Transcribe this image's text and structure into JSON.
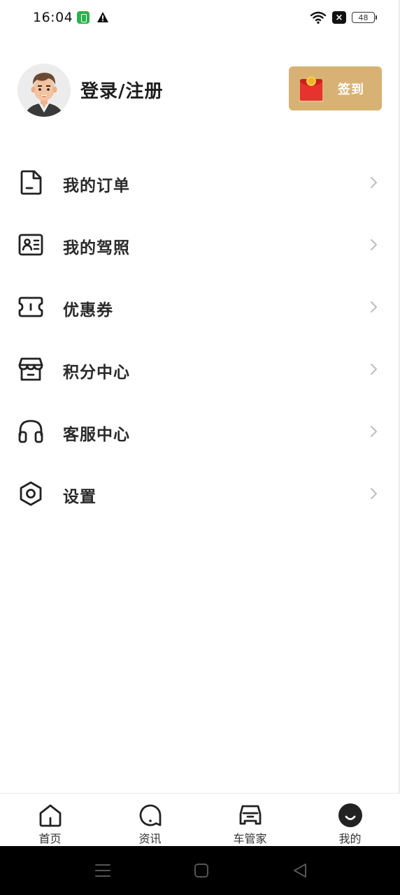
{
  "status_bar": {
    "time": "16:04",
    "app_icon": "app-notification-icon",
    "warning_icon": "warning-icon",
    "wifi_icon": "wifi-icon",
    "sim_icon": "x-sim-icon",
    "battery": "48"
  },
  "profile": {
    "login_label": "登录/注册",
    "checkin_label": "签到",
    "accent_color": "#d8b174"
  },
  "menu": {
    "items": [
      {
        "label": "我的订单",
        "icon": "document-icon"
      },
      {
        "label": "我的驾照",
        "icon": "license-card-icon"
      },
      {
        "label": "优惠券",
        "icon": "coupon-ticket-icon"
      },
      {
        "label": "积分中心",
        "icon": "store-icon"
      },
      {
        "label": "客服中心",
        "icon": "headphones-icon"
      },
      {
        "label": "设置",
        "icon": "hex-nut-settings-icon"
      }
    ]
  },
  "tabbar": {
    "tabs": [
      {
        "label": "首页",
        "icon": "home-icon",
        "active": false
      },
      {
        "label": "资讯",
        "icon": "news-chat-icon",
        "active": false
      },
      {
        "label": "车管家",
        "icon": "car-icon",
        "active": false
      },
      {
        "label": "我的",
        "icon": "profile-smile-icon",
        "active": true
      }
    ]
  }
}
